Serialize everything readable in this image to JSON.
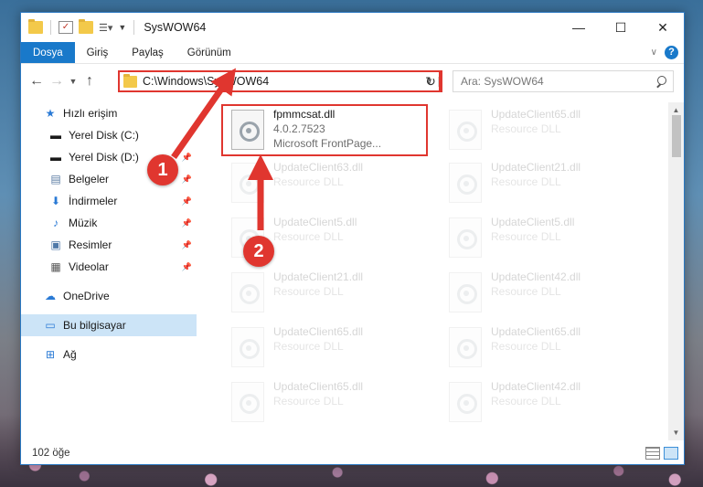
{
  "window": {
    "title": "SysWOW64"
  },
  "ribbon": {
    "tabs": [
      "Dosya",
      "Giriş",
      "Paylaş",
      "Görünüm"
    ]
  },
  "address": {
    "path": "C:\\Windows\\SysWOW64"
  },
  "search": {
    "placeholder": "Ara: SysWOW64"
  },
  "nav": {
    "items": [
      {
        "label": "Hızlı erişim",
        "icon": "star-icon"
      },
      {
        "label": "Yerel Disk (C:)",
        "icon": "drive-icon"
      },
      {
        "label": "Yerel Disk (D:)",
        "icon": "drive-icon"
      },
      {
        "label": "Belgeler",
        "icon": "documents-icon"
      },
      {
        "label": "İndirmeler",
        "icon": "download-icon"
      },
      {
        "label": "Müzik",
        "icon": "music-icon"
      },
      {
        "label": "Resimler",
        "icon": "pictures-icon"
      },
      {
        "label": "Videolar",
        "icon": "video-icon"
      },
      {
        "label": "OneDrive",
        "icon": "cloud-icon"
      },
      {
        "label": "Bu bilgisayar",
        "icon": "computer-icon"
      },
      {
        "label": "Ağ",
        "icon": "network-icon"
      }
    ]
  },
  "files": {
    "highlighted": {
      "name": "fpmmcsat.dll",
      "version": "4.0.2.7523",
      "description": "Microsoft FrontPage..."
    },
    "left_column": [
      {
        "name": "UpdateClient63.dll",
        "description": "Resource DLL"
      },
      {
        "name": "UpdateClient5.dll",
        "description": "Resource DLL"
      },
      {
        "name": "UpdateClient21.dll",
        "description": "Resource DLL"
      },
      {
        "name": "UpdateClient65.dll",
        "description": "Resource DLL"
      },
      {
        "name": "UpdateClient65.dll",
        "description": "Resource DLL"
      }
    ],
    "right_column": [
      {
        "name": "UpdateClient65.dll",
        "description": "Resource DLL"
      },
      {
        "name": "UpdateClient21.dll",
        "description": "Resource DLL"
      },
      {
        "name": "UpdateClient5.dll",
        "description": "Resource DLL"
      },
      {
        "name": "UpdateClient42.dll",
        "description": "Resource DLL"
      },
      {
        "name": "UpdateClient65.dll",
        "description": "Resource DLL"
      },
      {
        "name": "UpdateClient42.dll",
        "description": "Resource DLL"
      }
    ]
  },
  "status": {
    "item_count": "102 öğe"
  },
  "annotations": {
    "step1": "1",
    "step2": "2"
  },
  "colors": {
    "accent": "#1979ca",
    "highlight": "#e0362f",
    "selected_nav": "#cce4f7"
  }
}
